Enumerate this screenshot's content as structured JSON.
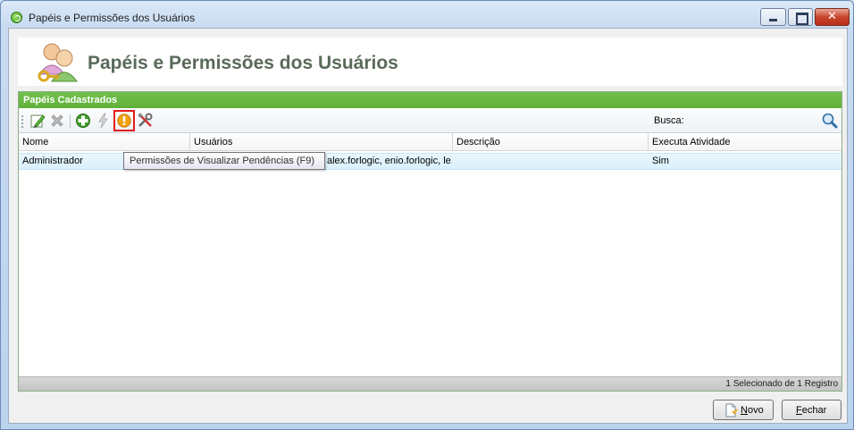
{
  "window": {
    "title": "Papéis e Permissões dos Usuários"
  },
  "header": {
    "title": "Papéis e Permissões dos Usuários",
    "icon": "users-key-icon"
  },
  "group": {
    "title": "Papéis Cadastrados"
  },
  "toolbar": {
    "buttons": [
      {
        "name": "edit-icon"
      },
      {
        "name": "delete-icon"
      },
      {
        "name": "add-icon"
      },
      {
        "name": "lightning-icon"
      },
      {
        "name": "warning-permission-icon",
        "highlighted": true
      },
      {
        "name": "tools-icon"
      }
    ],
    "search_label": "Busca:",
    "search_value": ""
  },
  "grid": {
    "columns": [
      "Nome",
      "Usuários",
      "Descrição",
      "Executa Atividade"
    ],
    "rows": [
      {
        "nome": "Administrador",
        "usuarios_visible": "alex.forlogic, enio.forlogic, le...",
        "descricao": "",
        "executa": "Sim"
      }
    ]
  },
  "tooltip": {
    "text": "Permissões de Visualizar Pendências (F9)"
  },
  "status": {
    "text": "1 Selecionado de 1 Registro"
  },
  "buttons": {
    "novo_underline": "N",
    "novo_rest": "ovo",
    "fechar_underline": "F",
    "fechar_rest": "echar"
  },
  "colors": {
    "group_header": "#5fb03b",
    "selected_row": "#d9f0fc",
    "highlight_border": "#e31b1b"
  }
}
